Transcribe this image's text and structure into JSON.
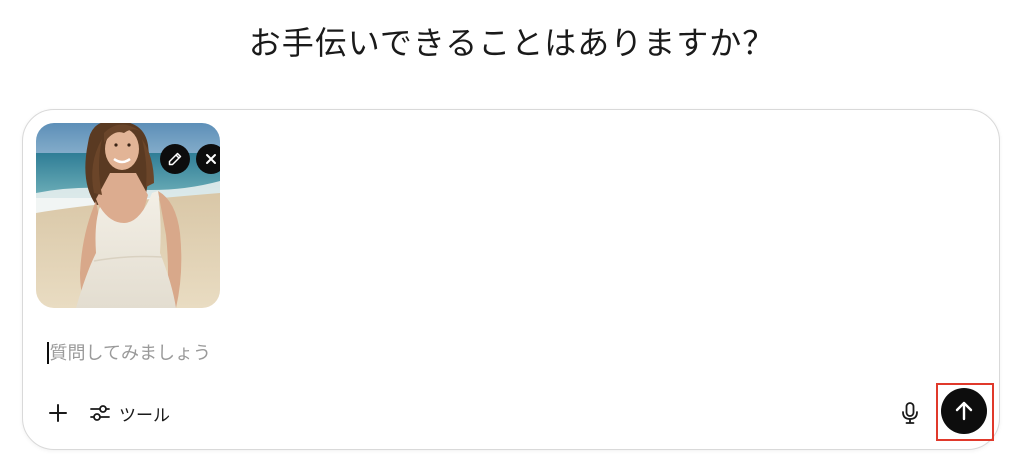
{
  "headline": "お手伝いできることはありますか？",
  "attachment": {
    "edit_icon": "pencil-icon",
    "remove_icon": "close-icon"
  },
  "prompt": {
    "value": "",
    "placeholder": "質問してみましょう"
  },
  "toolbar": {
    "add_icon": "plus-icon",
    "tools_icon": "sliders-icon",
    "tools_label": "ツール",
    "mic_icon": "microphone-icon",
    "send_icon": "arrow-up-icon"
  },
  "colors": {
    "send_button": "#0d0d0d",
    "highlight": "#e0392b",
    "placeholder": "#9a9a9a"
  }
}
